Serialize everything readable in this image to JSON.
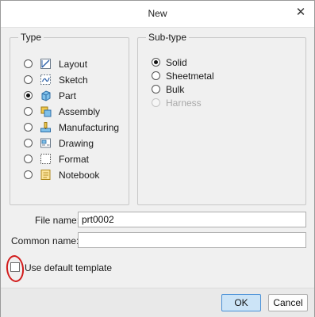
{
  "dialog": {
    "title": "New",
    "close_glyph": "✕"
  },
  "type_group": {
    "legend": "Type",
    "selected": "Part",
    "items": [
      {
        "label": "Layout",
        "icon": "layout-icon",
        "checked": false
      },
      {
        "label": "Sketch",
        "icon": "sketch-icon",
        "checked": false
      },
      {
        "label": "Part",
        "icon": "part-icon",
        "checked": true
      },
      {
        "label": "Assembly",
        "icon": "assembly-icon",
        "checked": false
      },
      {
        "label": "Manufacturing",
        "icon": "manufacturing-icon",
        "checked": false
      },
      {
        "label": "Drawing",
        "icon": "drawing-icon",
        "checked": false
      },
      {
        "label": "Format",
        "icon": "format-icon",
        "checked": false
      },
      {
        "label": "Notebook",
        "icon": "notebook-icon",
        "checked": false
      }
    ]
  },
  "subtype_group": {
    "legend": "Sub-type",
    "selected": "Solid",
    "items": [
      {
        "label": "Solid",
        "checked": true,
        "disabled": false
      },
      {
        "label": "Sheetmetal",
        "checked": false,
        "disabled": false
      },
      {
        "label": "Bulk",
        "checked": false,
        "disabled": false
      },
      {
        "label": "Harness",
        "checked": false,
        "disabled": true
      }
    ]
  },
  "fields": {
    "file_name_label": "File name:",
    "file_name_value": "prt0002",
    "common_name_label": "Common name:",
    "common_name_value": ""
  },
  "template": {
    "use_default_label": "Use default template",
    "checked": false
  },
  "buttons": {
    "ok": "OK",
    "cancel": "Cancel"
  },
  "colors": {
    "ok_button_bg": "#cce4f7",
    "ok_button_border": "#4a90d6",
    "annotation": "#d21b1b"
  }
}
